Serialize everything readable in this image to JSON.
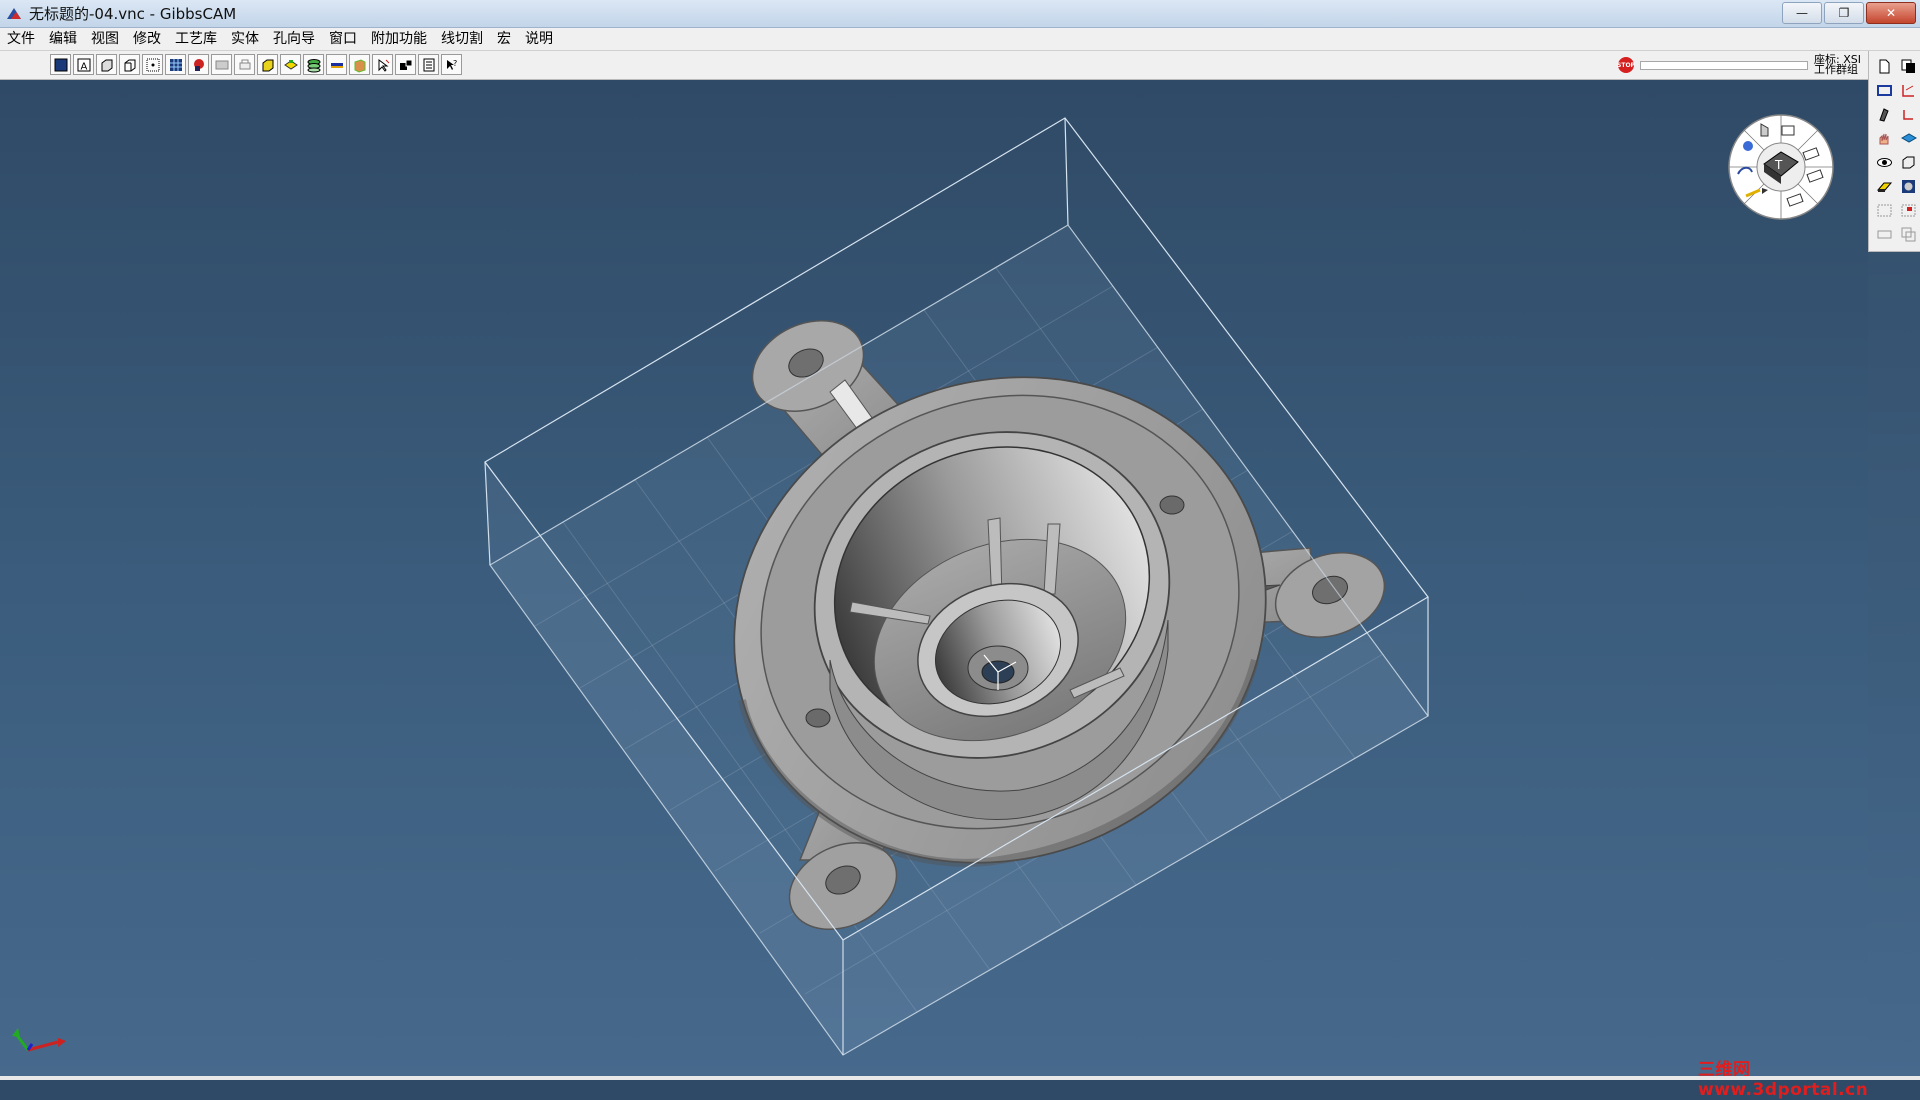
{
  "window": {
    "title": "无标题的-04.vnc - GibbsCAM",
    "minimize_label": "—",
    "restore_label": "❐",
    "close_label": "✕"
  },
  "menu": {
    "items": [
      "文件",
      "编辑",
      "视图",
      "修改",
      "工艺库",
      "实体",
      "孔向导",
      "窗口",
      "附加功能",
      "线切割",
      "宏",
      "说明"
    ]
  },
  "toolbar": {
    "icons": [
      "wireframe-view-icon",
      "text-view-icon",
      "shaded-box-icon",
      "box-outline-icon",
      "point-grid-icon",
      "grid-snap-icon",
      "red-shape-icon",
      "dimension-icon",
      "print-icon",
      "yellow-cube-icon",
      "yellow-solid-icon",
      "green-layers-icon",
      "blue-bar-icon",
      "orange-block-icon",
      "cursor-arrow-icon",
      "black-blocks-icon",
      "report-icon",
      "help-cursor-icon"
    ],
    "stop_label": "STOP",
    "coord_label_1": "座标: XSI",
    "coord_label_2": "工作群组"
  },
  "palette": {
    "icons": [
      "new-doc-icon",
      "copy-doc-icon",
      "rectangle-select-icon",
      "axis-red-icon",
      "clamp-icon",
      "axis-red-small-icon",
      "hand-icon",
      "blue-diamond-icon",
      "eye-icon",
      "cube-outline-icon",
      "eraser-icon",
      "render-icon",
      "grey-select-icon",
      "red-select-icon",
      "grey-doc-icon",
      "grey-copy-icon"
    ]
  },
  "watermark": "三维网www.3dportal.cn",
  "compass": {
    "center_label": "T"
  },
  "axes": {
    "x_label": "X",
    "y_label": "Y"
  },
  "colors": {
    "part_gray": "#9a9a9a",
    "bg_top": "#2f4a66",
    "bg_bottom": "#46698c",
    "stock_box": "#d6e3ef"
  }
}
